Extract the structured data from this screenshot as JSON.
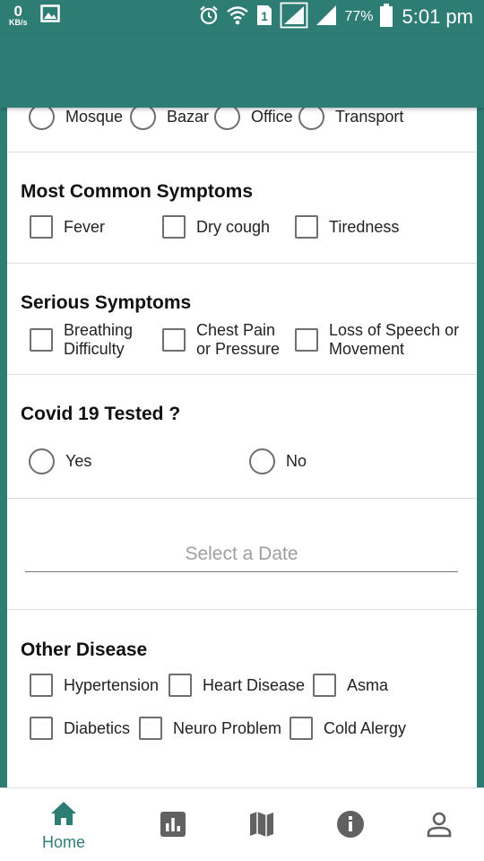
{
  "status_bar": {
    "speed_value": "0",
    "speed_unit": "KB/s",
    "sim_label": "1",
    "battery_pct": "77%",
    "time": "5:01 pm",
    "icons": [
      "image-icon",
      "alarm-icon",
      "wifi-icon",
      "sim-icon",
      "signal-icon",
      "signal-icon",
      "battery-icon"
    ]
  },
  "places": {
    "options": [
      "Mosque",
      "Bazar",
      "Office",
      "Transport"
    ]
  },
  "common_symptoms": {
    "title": "Most Common Symptoms",
    "options": [
      "Fever",
      "Dry cough",
      "Tiredness"
    ]
  },
  "serious_symptoms": {
    "title": "Serious Symptoms",
    "options": [
      "Breathing\nDifficulty",
      "Chest Pain\nor Pressure",
      "Loss of Speech or\nMovement"
    ]
  },
  "covid_test": {
    "title": "Covid 19 Tested ?",
    "options": [
      "Yes",
      "No"
    ]
  },
  "date_field": {
    "placeholder": "Select a Date"
  },
  "other_disease": {
    "title": "Other Disease",
    "options": [
      "Hypertension",
      "Heart Disease",
      "Asma",
      "Diabetics",
      "Neuro Problem",
      "Cold Alergy"
    ]
  },
  "bottom_nav": {
    "items": [
      {
        "icon": "home-icon",
        "label": "Home",
        "active": true
      },
      {
        "icon": "bar-chart-icon",
        "label": "",
        "active": false
      },
      {
        "icon": "map-icon",
        "label": "",
        "active": false
      },
      {
        "icon": "info-icon",
        "label": "",
        "active": false
      },
      {
        "icon": "person-icon",
        "label": "",
        "active": false
      }
    ]
  },
  "colors": {
    "primary": "#2e7d75",
    "nav_inactive": "#616161",
    "control_border": "#6e6e6e"
  }
}
